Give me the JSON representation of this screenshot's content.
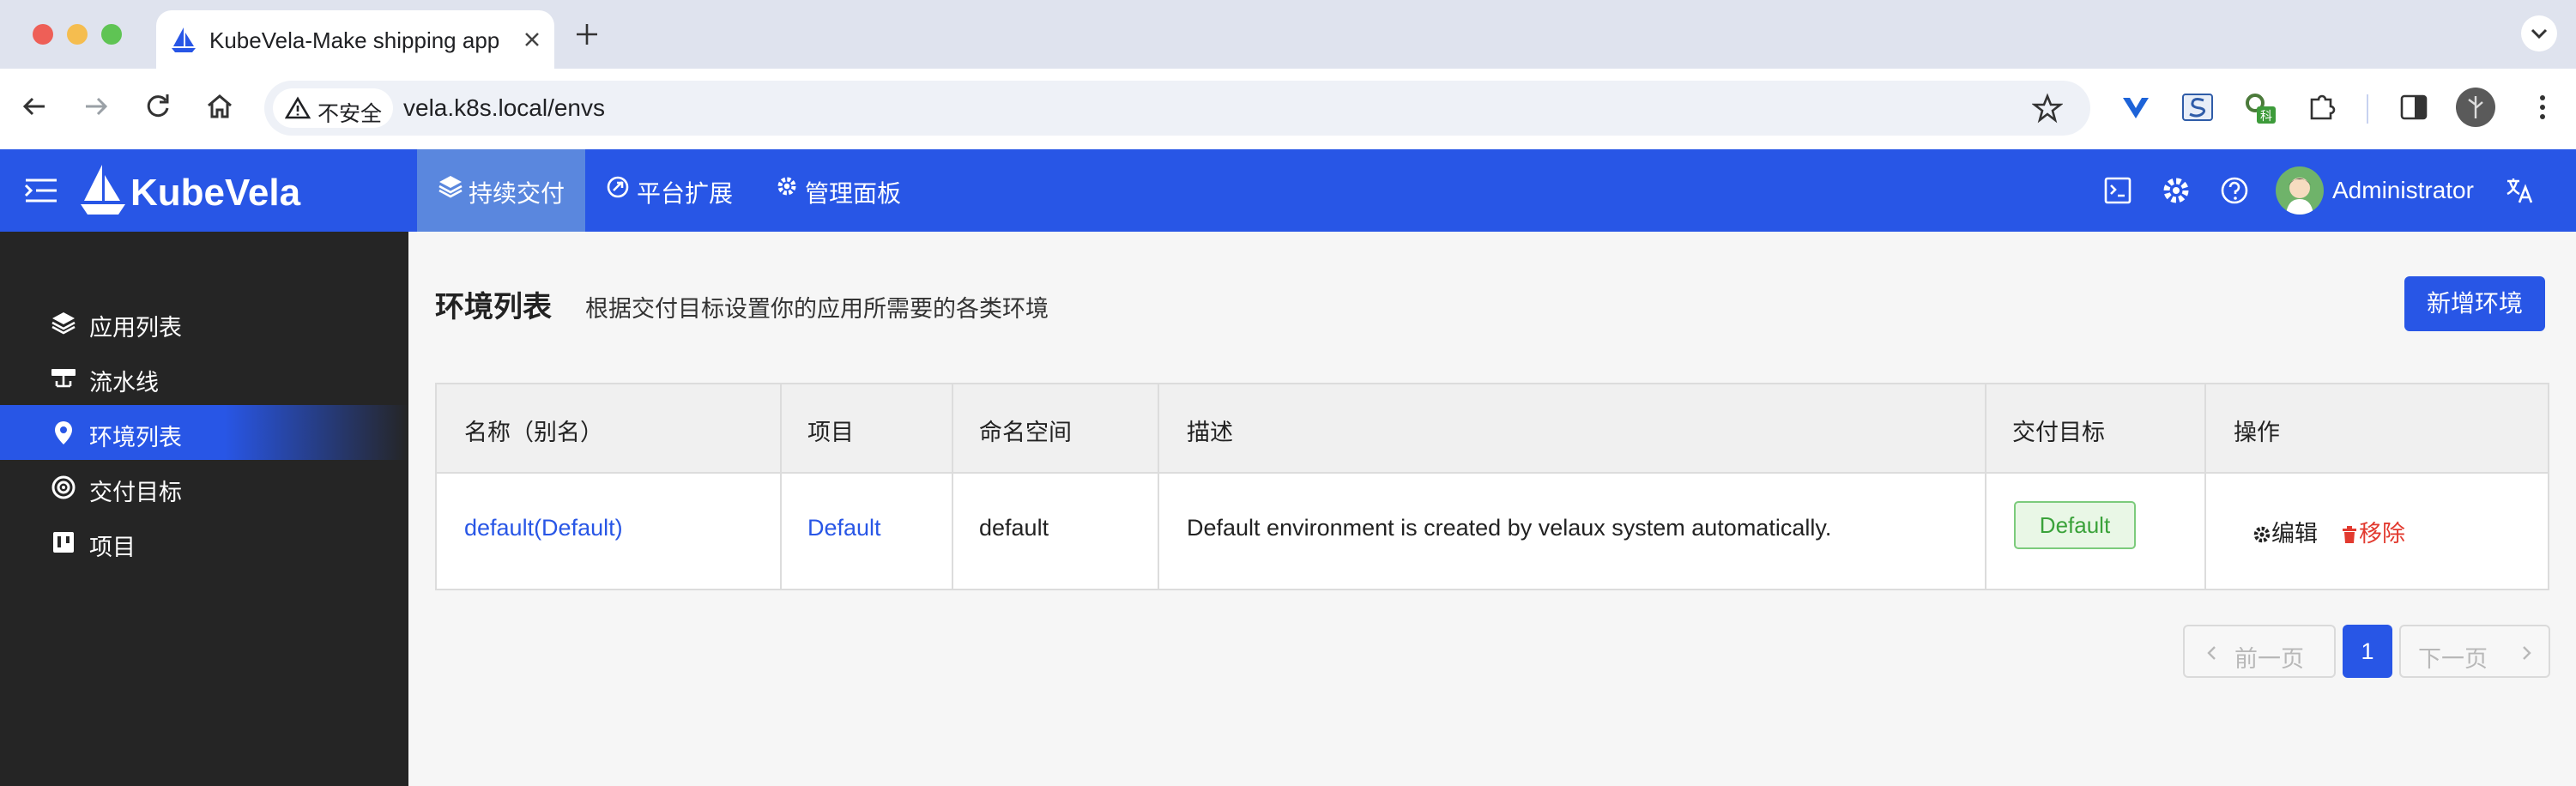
{
  "browser": {
    "tab_title": "KubeVela-Make shipping app",
    "security_label": "不安全",
    "url": "vela.k8s.local/envs"
  },
  "header": {
    "brand": "KubeVela",
    "nav_tabs": [
      {
        "label": "持续交付",
        "icon": "layers-icon",
        "active": true
      },
      {
        "label": "平台扩展",
        "icon": "extension-icon",
        "active": false
      },
      {
        "label": "管理面板",
        "icon": "gear-icon",
        "active": false
      }
    ],
    "user": "Administrator",
    "icons": [
      "terminal-icon",
      "settings-icon",
      "help-icon",
      "translate-icon"
    ]
  },
  "sidebar": {
    "items": [
      {
        "label": "应用列表",
        "icon": "layers-icon",
        "active": false
      },
      {
        "label": "流水线",
        "icon": "pipeline-icon",
        "active": false
      },
      {
        "label": "环境列表",
        "icon": "location-pin-icon",
        "active": true
      },
      {
        "label": "交付目标",
        "icon": "target-icon",
        "active": false
      },
      {
        "label": "项目",
        "icon": "project-icon",
        "active": false
      }
    ]
  },
  "main": {
    "title": "环境列表",
    "subtitle": "根据交付目标设置你的应用所需要的各类环境",
    "add_button": "新增环境",
    "table": {
      "columns": [
        "名称（别名）",
        "项目",
        "命名空间",
        "描述",
        "交付目标",
        "操作"
      ],
      "rows": [
        {
          "name": "default(Default)",
          "project": "Default",
          "namespace": "default",
          "description": "Default environment is created by velaux system automatically.",
          "target": "Default",
          "edit": "编辑",
          "remove": "移除"
        }
      ]
    },
    "pagination": {
      "prev": "前一页",
      "current": "1",
      "next": "下一页"
    }
  },
  "colors": {
    "brand": "#2856e6",
    "sidebar": "#252525",
    "danger": "#e23a2f",
    "success": "#3aa23a"
  }
}
